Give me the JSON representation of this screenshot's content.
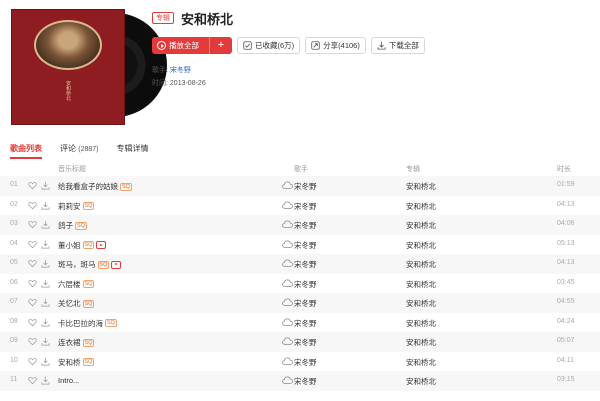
{
  "header": {
    "tag": "专辑",
    "title": "安和桥北",
    "cover_text": "安和桥北",
    "buttons": {
      "play_all": "播放全部",
      "add": "+",
      "collected": "已收藏(6万)",
      "share": "分享(4106)",
      "download_all": "下载全部"
    },
    "singer_label": "歌手:",
    "singer": "宋冬野",
    "date_label": "时间:",
    "date": "2013-08-26"
  },
  "tabs": [
    {
      "label": "歌曲列表",
      "count": ""
    },
    {
      "label": "评论",
      "count": "(2887)"
    },
    {
      "label": "专辑详情",
      "count": ""
    }
  ],
  "columns": {
    "title": "音乐标题",
    "singer": "歌手",
    "album": "专辑",
    "duration": "时长"
  },
  "songs": [
    {
      "num": "01",
      "title": "给我看盒子的姑娘",
      "sq": "SQ",
      "mv": false,
      "singer": "宋冬野",
      "album": "安和桥北",
      "duration": "01:59"
    },
    {
      "num": "02",
      "title": "莉莉安",
      "sq": "SQ",
      "mv": false,
      "singer": "宋冬野",
      "album": "安和桥北",
      "duration": "04:13"
    },
    {
      "num": "03",
      "title": "鸽子",
      "sq": "SQ",
      "mv": false,
      "singer": "宋冬野",
      "album": "安和桥北",
      "duration": "04:06"
    },
    {
      "num": "04",
      "title": "董小姐",
      "sq": "SQ",
      "mv": true,
      "singer": "宋冬野",
      "album": "安和桥北",
      "duration": "05:13"
    },
    {
      "num": "05",
      "title": "斑马，斑马",
      "sq": "SQ",
      "mv": true,
      "singer": "宋冬野",
      "album": "安和桥北",
      "duration": "04:13"
    },
    {
      "num": "06",
      "title": "六层楼",
      "sq": "SQ",
      "mv": false,
      "singer": "宋冬野",
      "album": "安和桥北",
      "duration": "03:45"
    },
    {
      "num": "07",
      "title": "关忆北",
      "sq": "SQ",
      "mv": false,
      "singer": "宋冬野",
      "album": "安和桥北",
      "duration": "04:55"
    },
    {
      "num": "08",
      "title": "卡比巴拉的海",
      "sq": "SQ",
      "mv": false,
      "singer": "宋冬野",
      "album": "安和桥北",
      "duration": "04:24"
    },
    {
      "num": "09",
      "title": "连衣裙",
      "sq": "SQ",
      "mv": false,
      "singer": "宋冬野",
      "album": "安和桥北",
      "duration": "05:07"
    },
    {
      "num": "10",
      "title": "安和桥",
      "sq": "SQ",
      "mv": false,
      "singer": "宋冬野",
      "album": "安和桥北",
      "duration": "04:11"
    },
    {
      "num": "11",
      "title": "Intro...",
      "sq": "",
      "mv": false,
      "singer": "宋冬野",
      "album": "安和桥北",
      "duration": "03:15"
    }
  ],
  "colors": {
    "accent": "#e33b3b",
    "link": "#2c66b8",
    "cover": "#8e1c20",
    "sq_badge": "#e8702a"
  },
  "icons": {
    "play": "play-circle-icon",
    "collect": "checkbox-icon",
    "share": "share-icon",
    "download": "download-icon",
    "like": "heart-icon",
    "cloud": "cloud-icon",
    "mv": "mv-icon"
  }
}
